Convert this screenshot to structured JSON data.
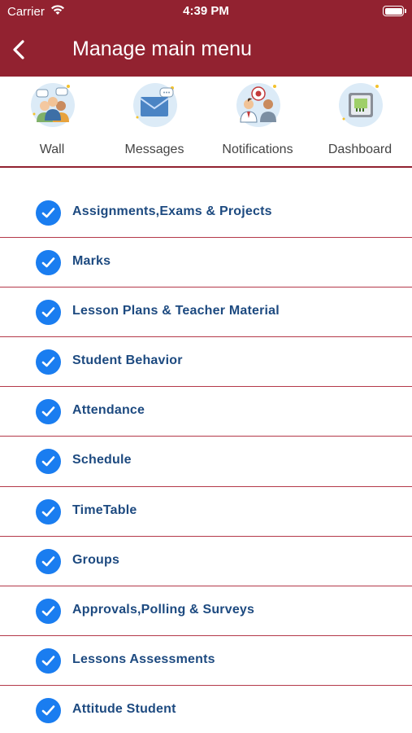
{
  "status_bar": {
    "carrier": "Carrier",
    "time": "4:39 PM"
  },
  "header": {
    "title": "Manage main menu",
    "back_icon": "chevron-left-icon"
  },
  "tabs": [
    {
      "label": "Wall",
      "icon": "group-people-icon"
    },
    {
      "label": "Messages",
      "icon": "envelope-chat-icon"
    },
    {
      "label": "Notifications",
      "icon": "people-alert-icon"
    },
    {
      "label": "Dashboard",
      "icon": "dashboard-chip-icon"
    }
  ],
  "menu_items": [
    {
      "label": "Assignments,Exams & Projects",
      "checked": true
    },
    {
      "label": "Marks",
      "checked": true
    },
    {
      "label": "Lesson Plans & Teacher Material",
      "checked": true
    },
    {
      "label": "Student Behavior",
      "checked": true
    },
    {
      "label": "Attendance",
      "checked": true
    },
    {
      "label": "Schedule",
      "checked": true
    },
    {
      "label": "TimeTable",
      "checked": true
    },
    {
      "label": "Groups",
      "checked": true
    },
    {
      "label": "Approvals,Polling & Surveys",
      "checked": true
    },
    {
      "label": "Lessons Assessments",
      "checked": true
    },
    {
      "label": "Attitude Student",
      "checked": true
    }
  ],
  "colors": {
    "header": "#922230",
    "check": "#1a7df0",
    "item_text": "#1d4a80",
    "divider": "#b4394a"
  }
}
